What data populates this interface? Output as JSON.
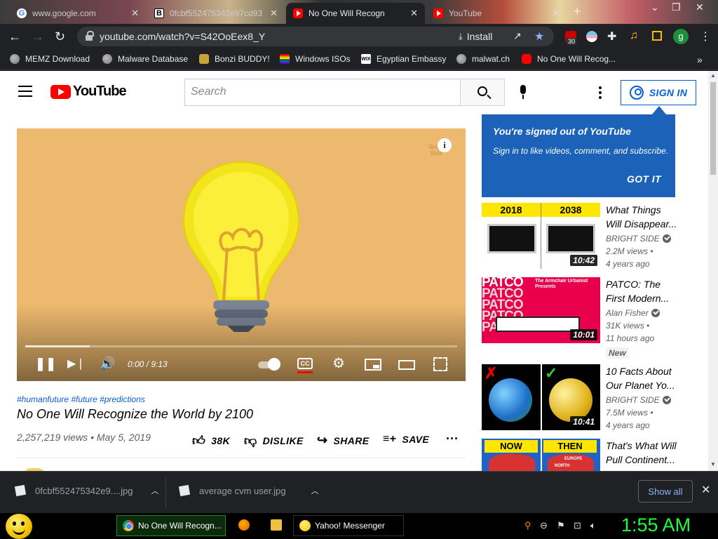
{
  "browser": {
    "tabs": [
      {
        "title": "www.google.com",
        "icon": "google-icon",
        "active": false
      },
      {
        "title": "0fcbf552475342e97cd93",
        "icon": "b-icon",
        "active": false
      },
      {
        "title": "No One Will Recogn",
        "icon": "youtube-icon",
        "active": true
      },
      {
        "title": "YouTube",
        "icon": "youtube-icon",
        "active": false
      }
    ],
    "new_tab": "+",
    "url": "youtube.com/watch?v=S42OoEex8_Y",
    "install_label": "Install",
    "extension_badge": "30",
    "profile_initial": "g",
    "bookmarks": [
      {
        "label": "MEMZ Download",
        "icon": "globe-icon"
      },
      {
        "label": "Malware Database",
        "icon": "globe-icon"
      },
      {
        "label": "Bonzi BUDDY!",
        "icon": "bonzi-icon"
      },
      {
        "label": "Windows ISOs",
        "icon": "rainbow-flag-icon"
      },
      {
        "label": "Egyptian Embassy",
        "icon": "wix-icon"
      },
      {
        "label": "malwat.ch",
        "icon": "globe-icon"
      },
      {
        "label": "No One Will Recog...",
        "icon": "youtube-icon"
      }
    ],
    "bookmarks_overflow": "»"
  },
  "youtube": {
    "logo_text": "YouTube",
    "search_placeholder": "Search",
    "sign_in_label": "SIGN IN",
    "promo": {
      "title": "You're signed out of YouTube",
      "body": "Sign in to like videos, comment, and subscribe.",
      "button": "GOT IT"
    },
    "player": {
      "timecode": "0:00 / 9:13",
      "watermark": "Bright Side",
      "info": "i",
      "cc_label": "CC",
      "buffered_fraction": 0.15
    },
    "video": {
      "hashtags": "#humanfuture #future #predictions",
      "title": "No One Will Recognize the World by 2100",
      "meta": "2,257,219 views • May 5, 2019",
      "likes": "38K",
      "dislike": "DISLIKE",
      "share": "SHARE",
      "save": "SAVE"
    },
    "related": [
      {
        "title1": "What Things",
        "title2": "Will Disappear...",
        "channel": "BRIGHT SIDE",
        "verified": true,
        "views": "2.2M views •",
        "age": "4 years ago",
        "duration": "10:42",
        "thumb_text_a": "2018",
        "thumb_text_b": "2038"
      },
      {
        "title1": "PATCO: The",
        "title2": "First Modern...",
        "channel": "Alan Fisher",
        "verified": true,
        "views": "31K views •",
        "age": "11 hours ago",
        "duration": "10:01",
        "badge": "New",
        "thumb_text_a": "PATCO",
        "thumb_text_b": "The Armchair Urbanist Presents"
      },
      {
        "title1": "10 Facts About",
        "title2": "Our Planet Yo...",
        "channel": "BRIGHT SIDE",
        "verified": true,
        "views": "7.5M views •",
        "age": "4 years ago",
        "duration": "10:41"
      },
      {
        "title1": "That's What Will",
        "title2": "Pull Continent...",
        "thumb_text_a": "NOW",
        "thumb_text_b": "THEN",
        "thumb_text_c": "EUROPE",
        "thumb_text_d": "NORTH"
      }
    ]
  },
  "downloads": {
    "items": [
      "0fcbf552475342e9....jpg",
      "average cvm user.jpg"
    ],
    "show_all": "Show all"
  },
  "taskbar": {
    "tasks": [
      "No One Will Recogn...",
      "Yahoo! Messenger"
    ],
    "clock": "1:55 AM"
  },
  "colors": {
    "accent_blue": "#065fd4",
    "promo_blue": "#1c62b9",
    "clock_green": "#18ff40",
    "video_bg": "#edb96e"
  }
}
